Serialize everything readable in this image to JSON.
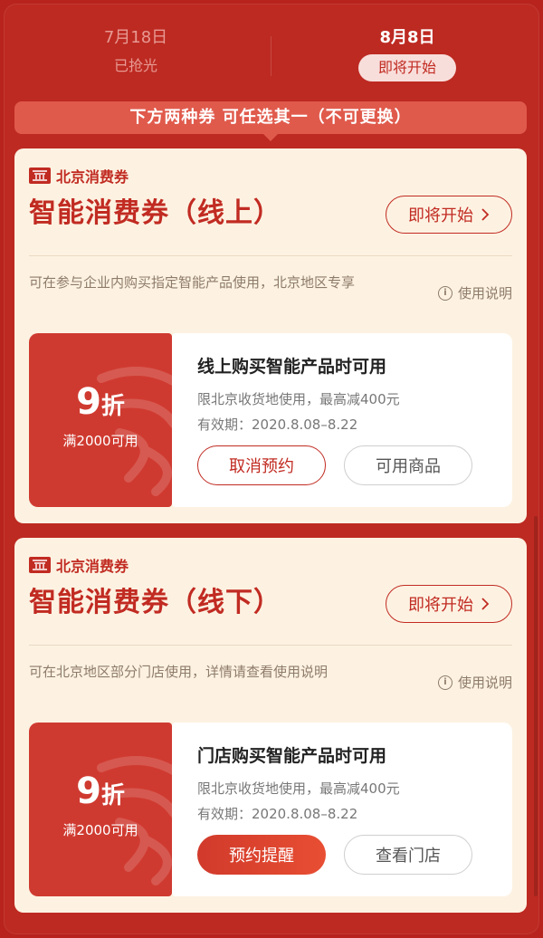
{
  "tabs": [
    {
      "date": "7月18日",
      "status": "已抢光"
    },
    {
      "date": "8月8日",
      "status": "即将开始"
    }
  ],
  "notice": "下方两种券 可任选其一（不可更换）",
  "cards": [
    {
      "brand": "北京消费券",
      "title": "智能消费券（线上）",
      "start_label": "即将开始",
      "description": "可在参与企业内购买指定智能产品使用，北京地区专享",
      "help_label": "使用说明",
      "coupon": {
        "discount_num": "9",
        "discount_unit": "折",
        "threshold": "满2000可用",
        "title": "线上购买智能产品时可用",
        "line1": "限北京收货地使用，最高减400元",
        "line2": "有效期：2020.8.08–8.22",
        "primary_button": "取消预约",
        "secondary_button": "可用商品"
      }
    },
    {
      "brand": "北京消费券",
      "title": "智能消费券（线下）",
      "start_label": "即将开始",
      "description": "可在北京地区部分门店使用，详情请查看使用说明",
      "help_label": "使用说明",
      "coupon": {
        "discount_num": "9",
        "discount_unit": "折",
        "threshold": "满2000可用",
        "title": "门店购买智能产品时可用",
        "line1": "限北京收货地使用，最高减400元",
        "line2": "有效期：2020.8.08–8.22",
        "primary_button": "预约提醒",
        "secondary_button": "查看门店"
      }
    }
  ],
  "colors": {
    "background": "#b8231d",
    "brand_red": "#c12b22",
    "card_bg": "#fdf2e2",
    "coupon_red": "#cf3a30"
  },
  "icons": [
    "brand-logo-icon",
    "chevron-right-icon",
    "info-icon"
  ]
}
